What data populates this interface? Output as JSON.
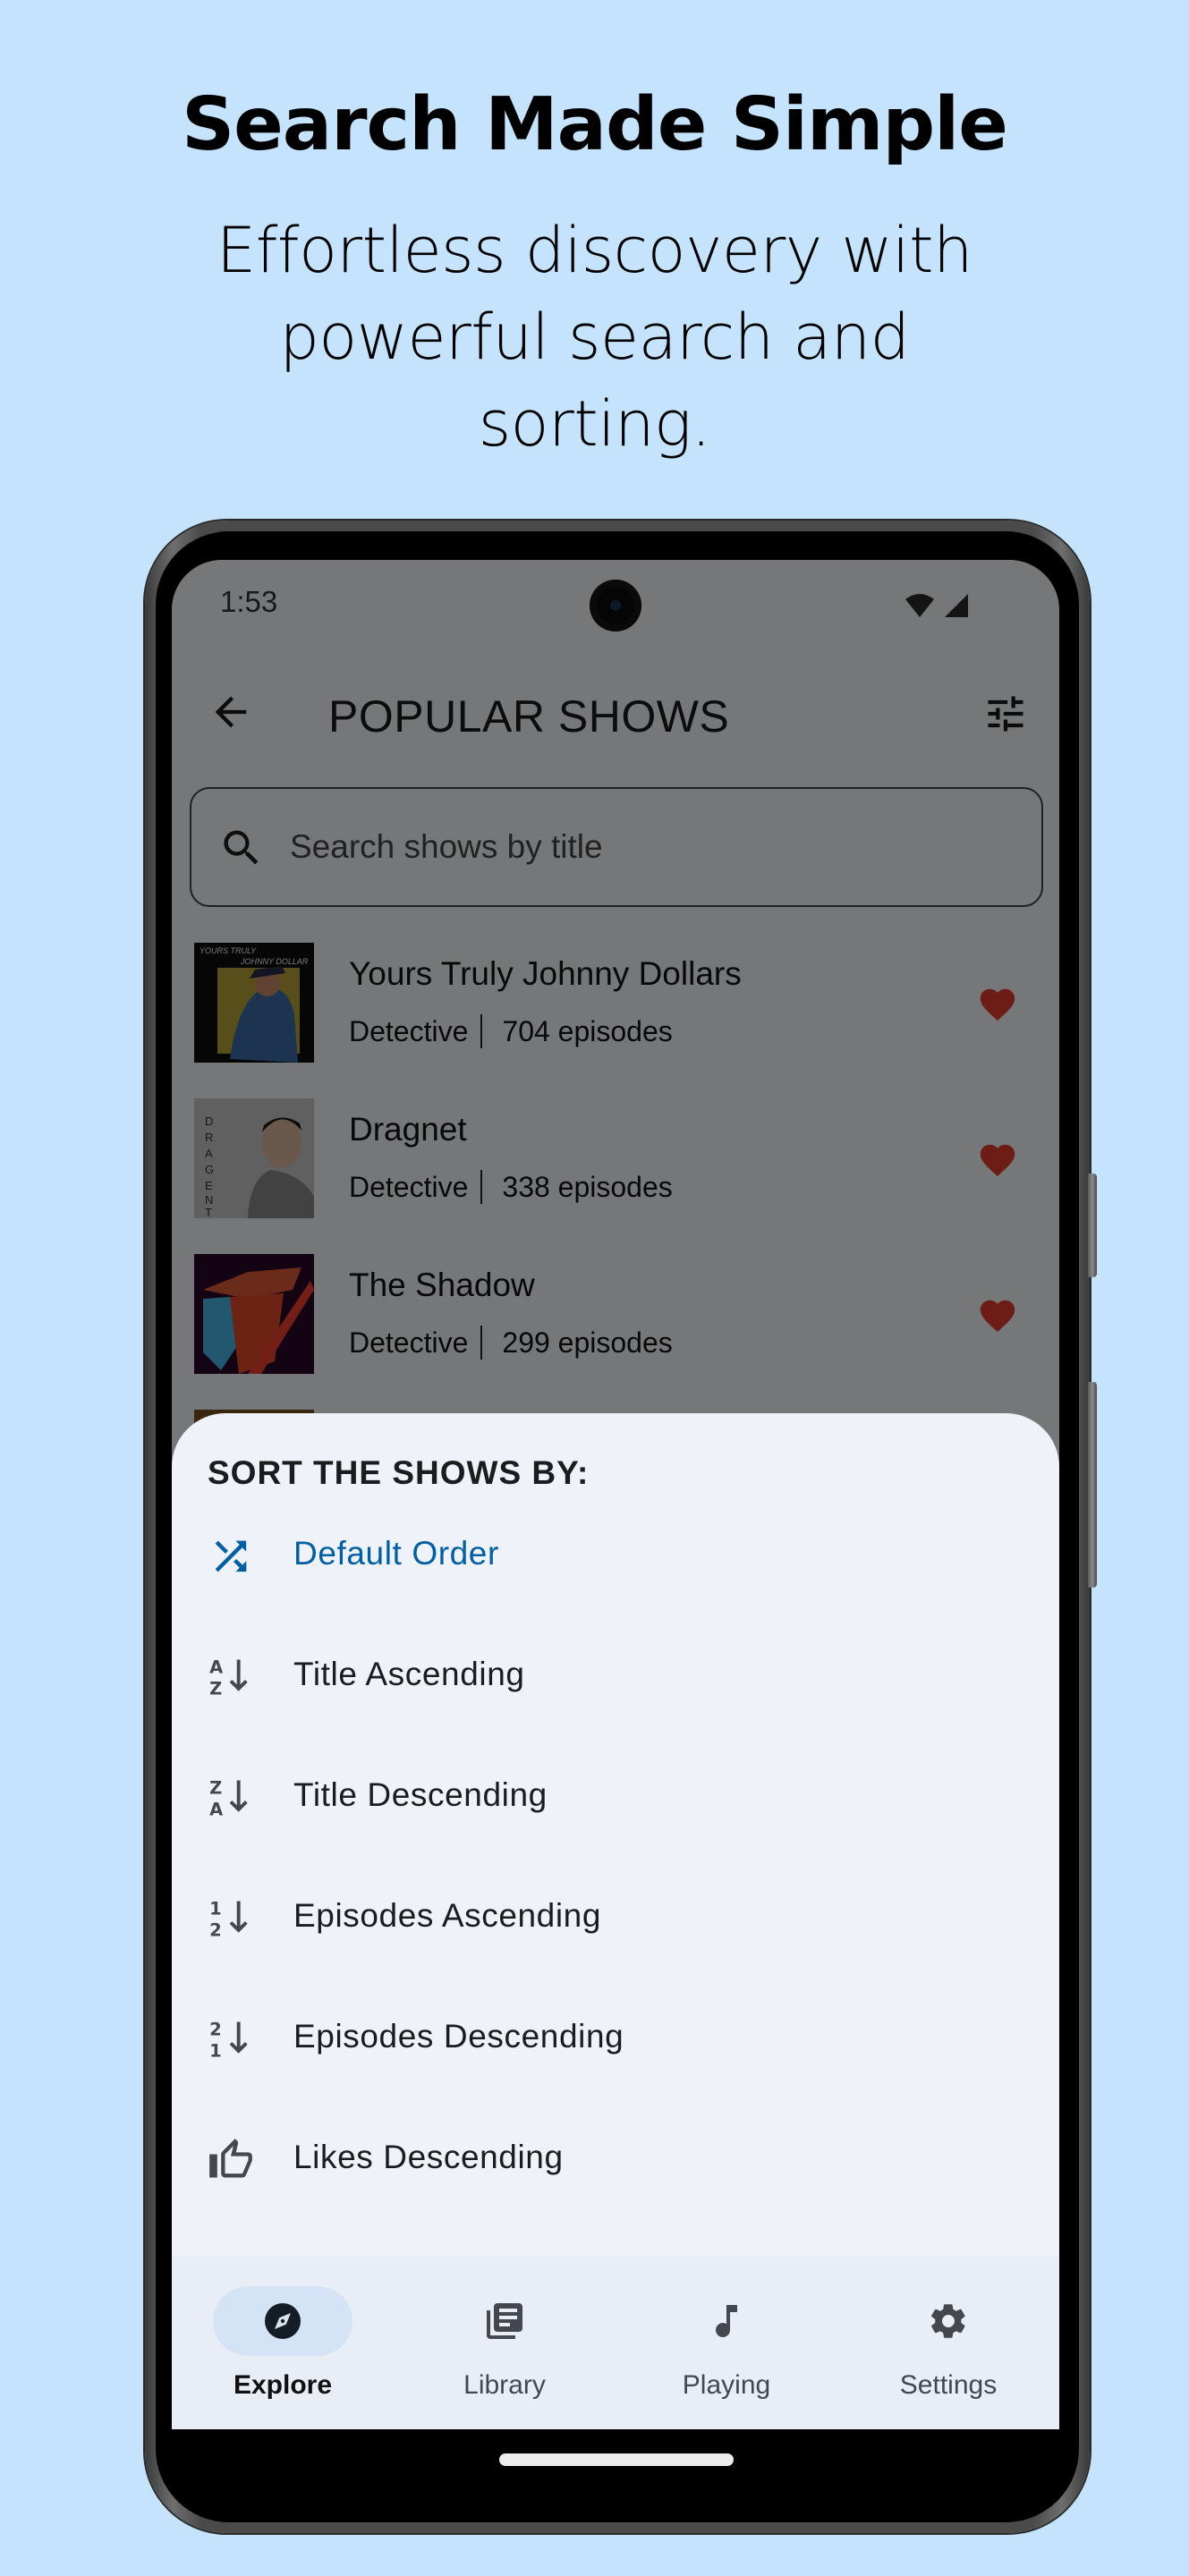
{
  "promo": {
    "headline": "Search Made Simple",
    "subhead": "Effortless discovery with powerful search and sorting."
  },
  "status_bar": {
    "time": "1:53",
    "icons": [
      "wifi-icon",
      "cellular-signal-icon"
    ]
  },
  "appbar": {
    "title": "POPULAR SHOWS",
    "back_icon": "arrow-back-icon",
    "filter_icon": "tune-sliders-icon"
  },
  "search": {
    "placeholder": "Search shows by title",
    "value": ""
  },
  "shows": [
    {
      "title": "Yours Truly Johnny Dollars",
      "genre": "Detective",
      "episodes": "704 episodes",
      "favorited": true,
      "cover_text": "YOURS TRULY JOHNNY DOLLAR"
    },
    {
      "title": "Dragnet",
      "genre": "Detective",
      "episodes": "338 episodes",
      "favorited": true,
      "cover_text": "DRAGENT"
    },
    {
      "title": "The Shadow",
      "genre": "Detective",
      "episodes": "299 episodes",
      "favorited": true,
      "cover_text": ""
    }
  ],
  "sort_sheet": {
    "title": "SORT THE SHOWS BY:",
    "selected_index": 0,
    "options": [
      {
        "label": "Default Order",
        "icon": "shuffle-icon"
      },
      {
        "label": "Title Ascending",
        "icon": "sort-az-icon"
      },
      {
        "label": "Title Descending",
        "icon": "sort-za-icon"
      },
      {
        "label": "Episodes Ascending",
        "icon": "sort-12-icon"
      },
      {
        "label": "Episodes Descending",
        "icon": "sort-21-icon"
      },
      {
        "label": "Likes Descending",
        "icon": "thumb-up-icon"
      }
    ]
  },
  "bottom_nav": {
    "selected": "Explore",
    "items": [
      {
        "label": "Explore",
        "icon": "compass-icon"
      },
      {
        "label": "Library",
        "icon": "library-icon"
      },
      {
        "label": "Playing",
        "icon": "music-note-icon"
      },
      {
        "label": "Settings",
        "icon": "gear-icon"
      }
    ]
  },
  "colors": {
    "page_background": "#c5e3fd",
    "accent": "#005fa3",
    "heart": "#c0281f",
    "sheet_background": "#eff3f9",
    "nav_background": "#e9eef6",
    "nav_active_pill": "#d5e3f6"
  }
}
